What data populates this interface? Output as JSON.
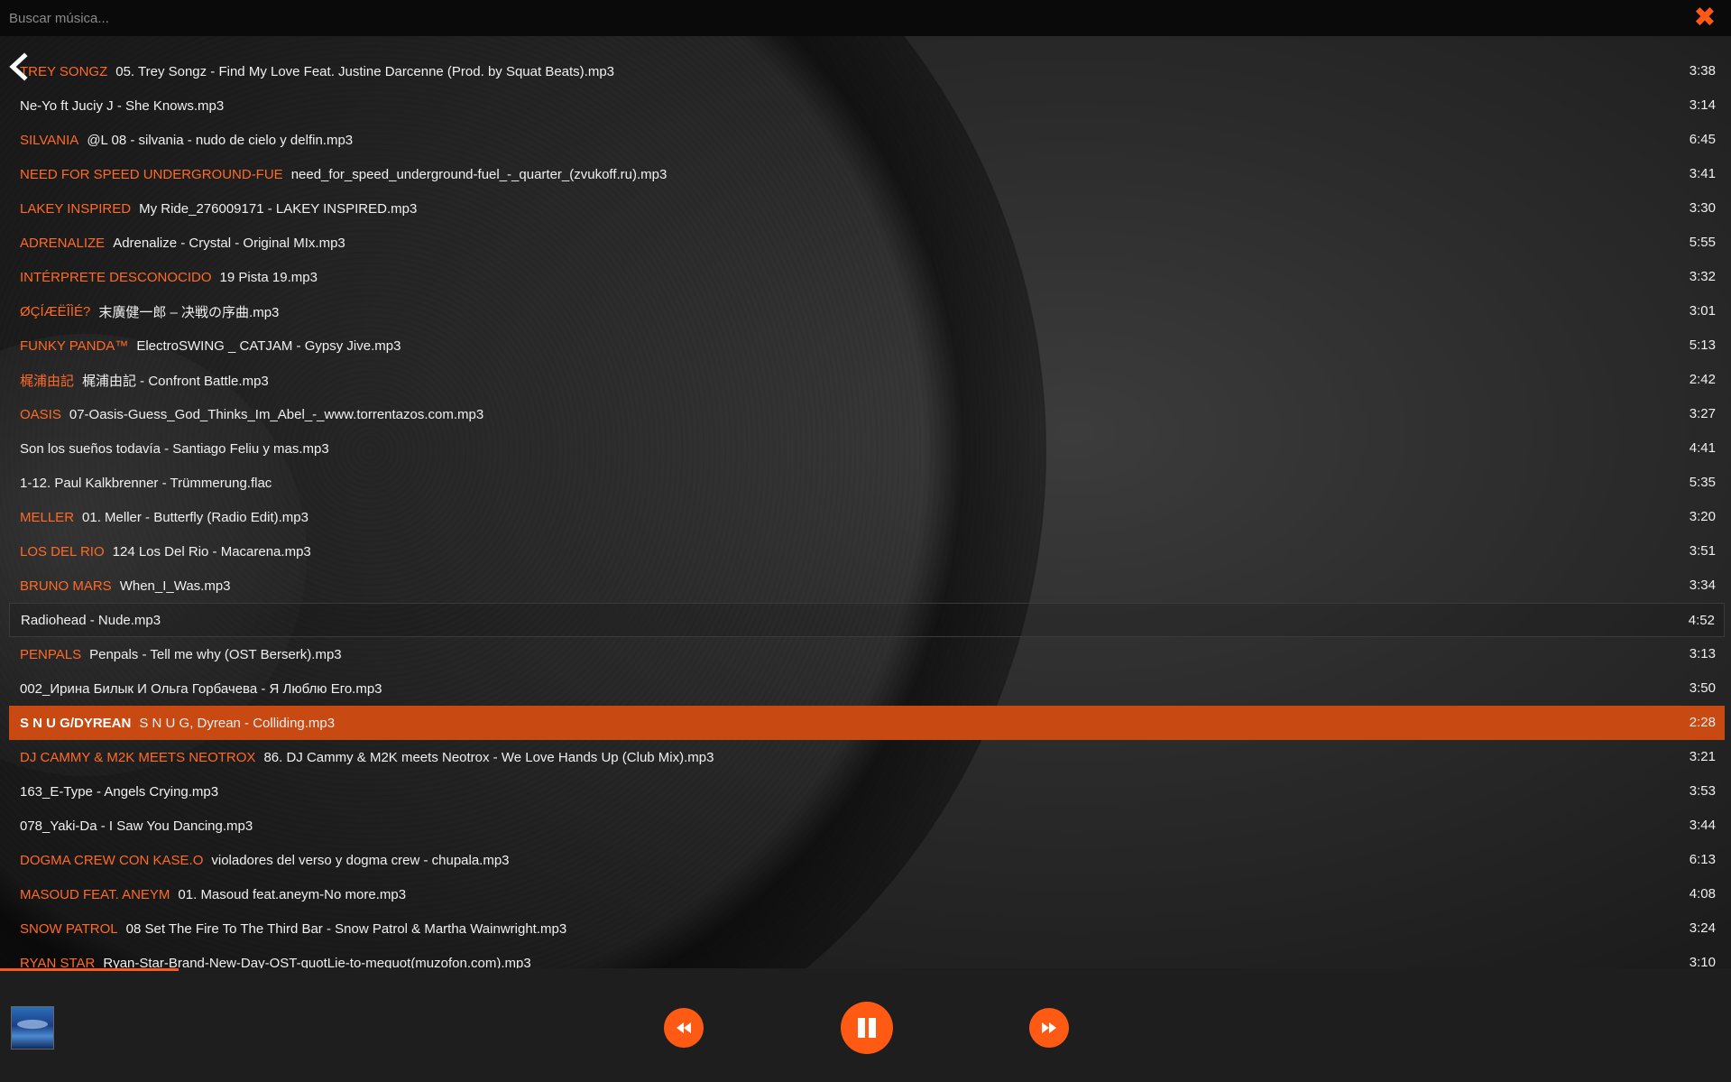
{
  "search": {
    "placeholder": "Buscar música..."
  },
  "close_glyph": "✖",
  "tracks": [
    {
      "artist": "TREY SONGZ",
      "title": "05. Trey Songz - Find My Love Feat. Justine Darcenne (Prod. by Squat Beats).mp3",
      "duration": "3:38"
    },
    {
      "artist": "",
      "title": "Ne-Yo ft Juciy J - She Knows.mp3",
      "duration": "3:14"
    },
    {
      "artist": "SILVANIA",
      "title": "@L 08 - silvania - nudo de cielo y delfin.mp3",
      "duration": "6:45"
    },
    {
      "artist": "NEED FOR SPEED UNDERGROUND-FUE",
      "title": "need_for_speed_underground-fuel_-_quarter_(zvukoff.ru).mp3",
      "duration": "3:41"
    },
    {
      "artist": "LAKEY INSPIRED",
      "title": "My Ride_276009171 - LAKEY INSPIRED.mp3",
      "duration": "3:30"
    },
    {
      "artist": "ADRENALIZE",
      "title": "Adrenalize - Crystal - Original MIx.mp3",
      "duration": "5:55"
    },
    {
      "artist": "INTÉRPRETE DESCONOCIDO",
      "title": "19 Pista 19.mp3",
      "duration": "3:32"
    },
    {
      "artist": "ØÇÍÆËÎÌÉ?",
      "title": "末廣健一郎 – 决戦の序曲.mp3",
      "duration": "3:01"
    },
    {
      "artist": "FUNKY PANDA™",
      "title": "ElectroSWING _ CATJAM - Gypsy Jive.mp3",
      "duration": "5:13"
    },
    {
      "artist": "梶浦由記",
      "title": "梶浦由記 - Confront Battle.mp3",
      "duration": "2:42"
    },
    {
      "artist": "OASIS",
      "title": "07-Oasis-Guess_God_Thinks_Im_Abel_-_www.torrentazos.com.mp3",
      "duration": "3:27"
    },
    {
      "artist": "",
      "title": "Son los sueños todavía - Santiago Feliu y mas.mp3",
      "duration": "4:41"
    },
    {
      "artist": "",
      "title": "1-12. Paul Kalkbrenner - Trümmerung.flac",
      "duration": "5:35"
    },
    {
      "artist": "MELLER",
      "title": "01. Meller - Butterfly (Radio Edit).mp3",
      "duration": "3:20"
    },
    {
      "artist": "LOS DEL RIO",
      "title": "124 Los Del Rio - Macarena.mp3",
      "duration": "3:51"
    },
    {
      "artist": "BRUNO MARS",
      "title": "When_I_Was.mp3",
      "duration": "3:34"
    },
    {
      "artist": "",
      "title": "Radiohead - Nude.mp3",
      "duration": "4:52",
      "state": "outlined"
    },
    {
      "artist": "PENPALS",
      "title": "Penpals - Tell me why (OST Berserk).mp3",
      "duration": "3:13"
    },
    {
      "artist": "",
      "title": "002_Ирина Билык И Ольга Горбачева - Я Люблю Его.mp3",
      "duration": "3:50"
    },
    {
      "artist": "S N U G/DYREAN",
      "title": "S N U G, Dyrean - Colliding.mp3",
      "duration": "2:28",
      "state": "active"
    },
    {
      "artist": "DJ CAMMY & M2K MEETS NEOTROX",
      "title": "86. DJ Cammy & M2K meets Neotrox - We Love Hands Up (Club Mix).mp3",
      "duration": "3:21"
    },
    {
      "artist": "",
      "title": "163_E-Type - Angels Crying.mp3",
      "duration": "3:53"
    },
    {
      "artist": "",
      "title": "078_Yaki-Da - I Saw You Dancing.mp3",
      "duration": "3:44"
    },
    {
      "artist": "DOGMA CREW CON KASE.O",
      "title": "violadores del verso y dogma crew - chupala.mp3",
      "duration": "6:13"
    },
    {
      "artist": "MASOUD FEAT. ANEYM",
      "title": "01. Masoud feat.aneym-No more.mp3",
      "duration": "4:08"
    },
    {
      "artist": "SNOW PATROL",
      "title": "08 Set The Fire To The Third Bar - Snow Patrol & Martha Wainwright.mp3",
      "duration": "3:24"
    },
    {
      "artist": "RYAN STAR",
      "title": "Ryan-Star-Brand-New-Day-OST-quotLie-to-mequot(muzofon.com).mp3",
      "duration": "3:10"
    }
  ],
  "player": {
    "progress_fraction": 0.103,
    "state": "playing",
    "controls": {
      "prev_icon": "rewind-icon",
      "play_icon": "pause-icon",
      "next_icon": "fast-forward-icon"
    }
  },
  "colors": {
    "accent": "#ff5a14",
    "artist_text": "#ff6a28",
    "active_row": "#c84912",
    "search_bar_bg": "#0a0a0a",
    "player_bg": "#1e1e1e"
  }
}
